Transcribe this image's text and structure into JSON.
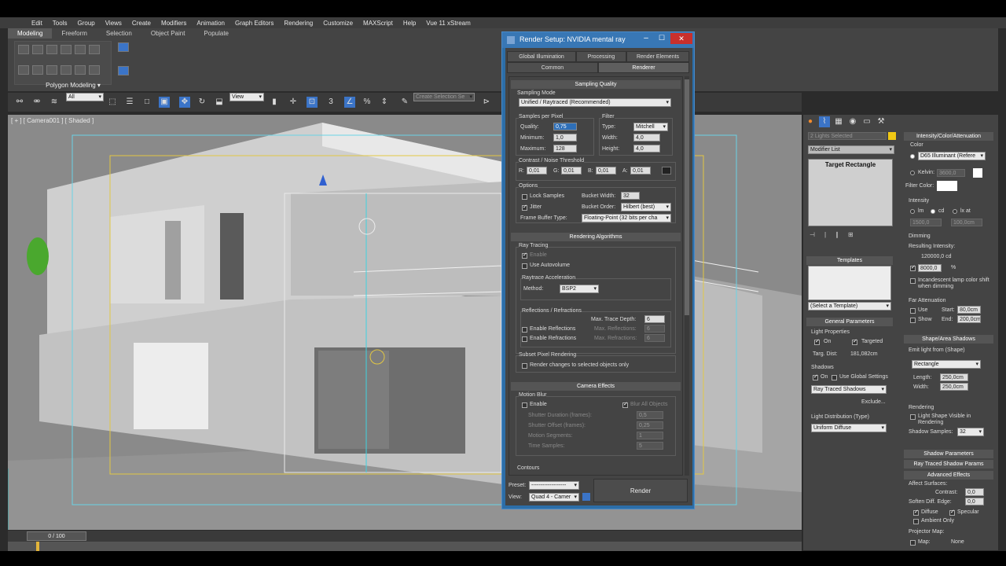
{
  "menu": [
    "Edit",
    "Tools",
    "Group",
    "Views",
    "Create",
    "Modifiers",
    "Animation",
    "Graph Editors",
    "Rendering",
    "Customize",
    "MAXScript",
    "Help",
    "Vue 11 xStream"
  ],
  "ribbon": {
    "tabs": [
      "Modeling",
      "Freeform",
      "Selection",
      "Object Paint",
      "Populate"
    ],
    "group_label": "Polygon Modeling ▾"
  },
  "toolbar": {
    "filter": "All",
    "ref_coord": "View",
    "named_sel": "Create Selection Se"
  },
  "viewport": {
    "label": "[ + ] [ Camera001 ] [ Shaded ]"
  },
  "timeline": {
    "frame": "0 / 100"
  },
  "dialog": {
    "title": "Render Setup: NVIDIA mental ray",
    "tabs_row1": [
      "Global Illumination",
      "Processing",
      "Render Elements"
    ],
    "tabs_row2": [
      "Common",
      "Renderer"
    ],
    "sampling_quality": "Sampling Quality",
    "sampling_mode_label": "Sampling Mode",
    "sampling_mode": "Unified / Raytraced (Recommended)",
    "spp_label": "Samples per Pixel",
    "quality_label": "Quality:",
    "quality": "0,75",
    "minimum_label": "Minimum:",
    "minimum": "1,0",
    "maximum_label": "Maximum:",
    "maximum": "128",
    "filter_label": "Filter",
    "type_label": "Type:",
    "type": "Mitchell",
    "width_label": "Width:",
    "width": "4,0",
    "height_label": "Height:",
    "height": "4,0",
    "contrast_label": "Contrast / Noise Threshold",
    "r_label": "R:",
    "r": "0,01",
    "g_label": "G:",
    "g": "0,01",
    "b_label": "B:",
    "b": "0,01",
    "a_label": "A:",
    "a": "0,01",
    "options_label": "Options",
    "lock_samples": "Lock Samples",
    "jitter": "Jitter",
    "bucket_width_label": "Bucket Width:",
    "bucket_width": "32",
    "bucket_order_label": "Bucket Order:",
    "bucket_order": "Hilbert (best)",
    "fb_type_label": "Frame Buffer Type:",
    "fb_type": "Floating-Point (32 bits per cha",
    "rendering_algorithms": "Rendering Algorithms",
    "ray_tracing": "Ray Tracing",
    "enable": "Enable",
    "use_autovolume": "Use Autovolume",
    "raytrace_accel": "Raytrace Acceleration",
    "method_label": "Method:",
    "method": "BSP2",
    "refl_refr": "Reflections / Refractions",
    "max_trace_label": "Max. Trace Depth:",
    "max_trace": "6",
    "enable_refl": "Enable Reflections",
    "max_refl_label": "Max. Reflections:",
    "max_refl": "6",
    "enable_refr": "Enable Refractions",
    "max_refr_label": "Max. Refractions:",
    "max_refr": "6",
    "subset_label": "Subset Pixel Rendering",
    "subset_text": "Render changes to selected objects only",
    "camera_effects": "Camera Effects",
    "motion_blur": "Motion Blur",
    "mb_enable": "Enable",
    "blur_all": "Blur All Objects",
    "shutter_dur_label": "Shutter Duration (frames):",
    "shutter_dur": "0,5",
    "shutter_off_label": "Shutter Offset (frames):",
    "shutter_off": "0,25",
    "motion_seg_label": "Motion Segments:",
    "motion_seg": "1",
    "time_samples_label": "Time Samples:",
    "time_samples": "5",
    "contours": "Contours",
    "preset_label": "Preset:",
    "preset": "-------------------",
    "view_label": "View:",
    "view": "Quad 4 - Camer",
    "render_btn": "Render"
  },
  "modify": {
    "sel_count": "2 Lights Selected",
    "modifier_list": "Modifier List",
    "stack_item": "Target Rectangle",
    "templates": "Templates",
    "select_template": "(Select a Template)",
    "general_params": "General Parameters",
    "light_props": "Light Properties",
    "on": "On",
    "targeted": "Targeted",
    "targ_dist_label": "Targ. Dist:",
    "targ_dist": "181,082cm",
    "shadows": "Shadows",
    "shadows_on": "On",
    "use_global": "Use Global Settings",
    "shadow_type": "Ray Traced Shadows",
    "exclude": "Exclude...",
    "light_dist_label": "Light Distribution (Type)",
    "light_dist": "Uniform Diffuse"
  },
  "intensity": {
    "header": "Intensity/Color/Attenuation",
    "color_label": "Color",
    "color_preset": "D65 Illuminant (Refere",
    "kelvin_label": "Kelvin:",
    "kelvin": "3600,0",
    "filter_color_label": "Filter Color:",
    "intensity_label": "Intensity",
    "lm": "lm",
    "cd": "cd",
    "lxat": "lx at",
    "int_val": "1500,0",
    "int_dist": "100,0cm",
    "dimming": "Dimming",
    "resulting_label": "Resulting Intensity:",
    "resulting": "120000,0 cd",
    "dim_pct": "8000,0",
    "pct": "%",
    "incandescent": "Incandescent lamp color shift when dimming",
    "far_atten": "Far Attenuation",
    "use": "Use",
    "show": "Show",
    "start_label": "Start:",
    "start": "80,0cm",
    "end_label": "End:",
    "end": "200,0cm",
    "shape_header": "Shape/Area Shadows",
    "emit_label": "Emit light from (Shape)",
    "shape": "Rectangle",
    "length_label": "Length:",
    "length": "250,0cm",
    "width_label": "Width:",
    "width": "250,0cm",
    "rendering": "Rendering",
    "light_shape_visible": "Light Shape Visible in Rendering",
    "shadow_samples_label": "Shadow Samples:",
    "shadow_samples": "32",
    "shadow_params": "Shadow Parameters",
    "ray_shadow_params": "Ray Traced Shadow Params",
    "advanced_effects": "Advanced Effects",
    "affect_surfaces": "Affect Surfaces:",
    "contrast_label": "Contrast:",
    "contrast": "0,0",
    "soften_label": "Soften Diff. Edge:",
    "soften": "0,0",
    "diffuse": "Diffuse",
    "specular": "Specular",
    "ambient_only": "Ambient Only",
    "projector_map": "Projector Map:",
    "map_label": "Map:",
    "map": "None"
  },
  "colors": {
    "accent": "#3877b5",
    "viewport": "#8c8c8c",
    "dialog_bg": "#444444"
  }
}
